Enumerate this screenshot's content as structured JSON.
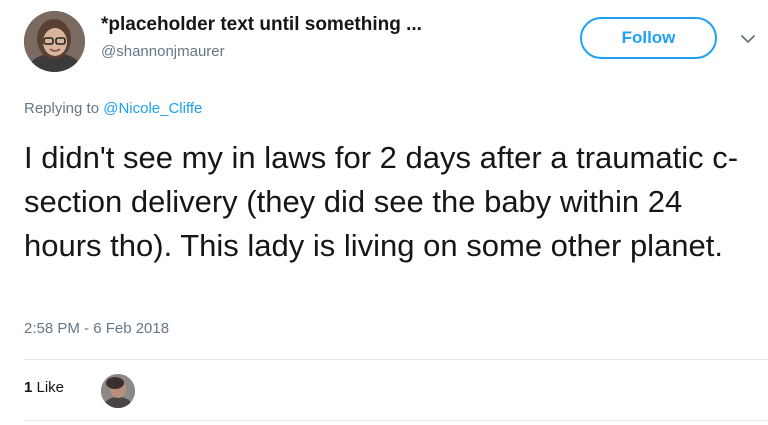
{
  "author": {
    "display_name": "*placeholder text until something ...",
    "handle": "@shannonjmaurer"
  },
  "follow_button": {
    "label": "Follow"
  },
  "reply": {
    "prefix": "Replying to ",
    "mention": "@Nicole_Cliffe"
  },
  "tweet": {
    "text": "I didn't see my in laws for 2 days after a traumatic c-section delivery (they did see the baby within 24 hours tho). This lady is living on some other planet.",
    "timestamp": "2:58 PM - 6 Feb 2018"
  },
  "stats": {
    "like_count": "1",
    "like_label": " Like"
  },
  "colors": {
    "accent": "#1da1f2",
    "secondary_text": "#657786",
    "divider": "#e1e8ed"
  },
  "icons": {
    "menu": "chevron-down-icon"
  }
}
